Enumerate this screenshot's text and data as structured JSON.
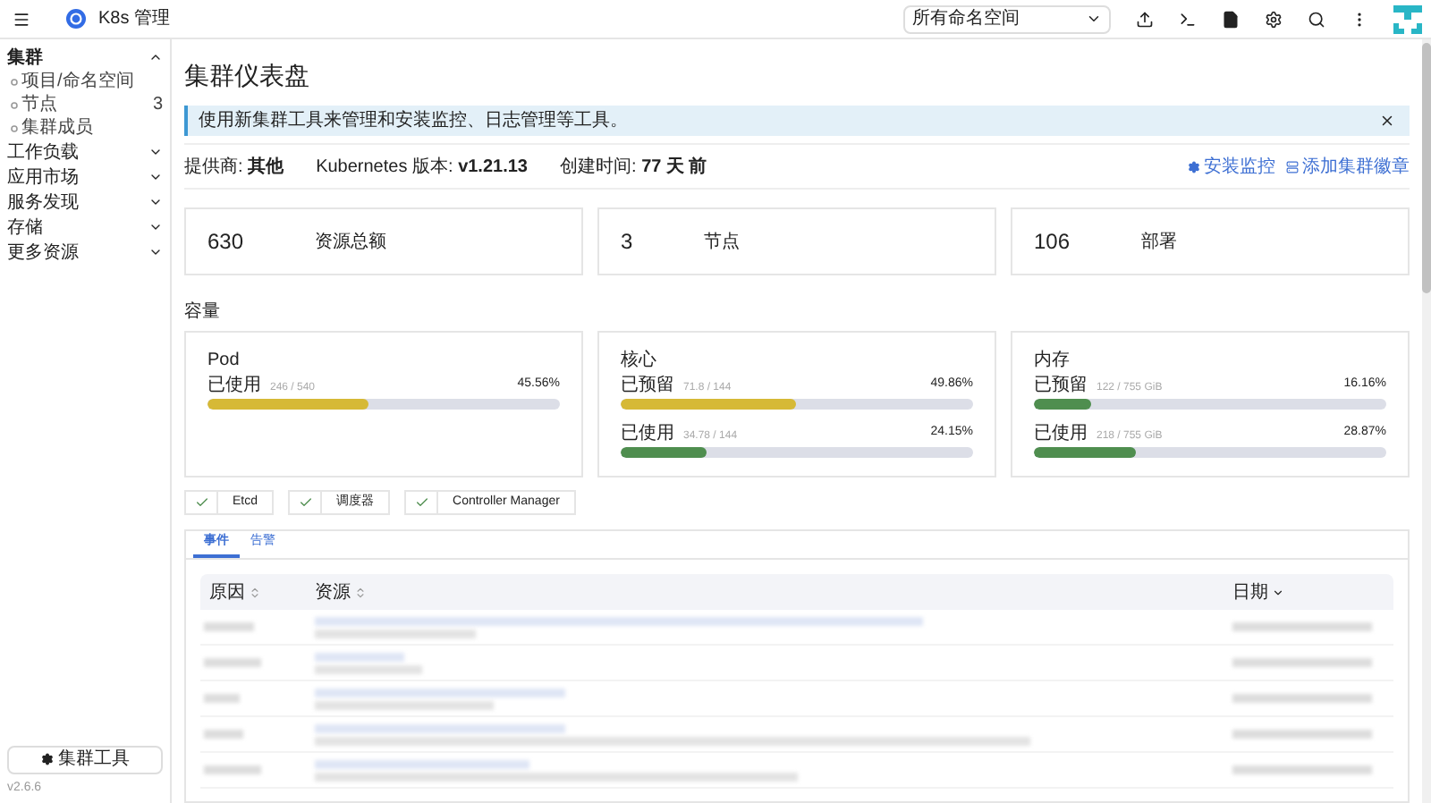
{
  "header": {
    "title": "K8s 管理",
    "namespace_select": "所有命名空间"
  },
  "sidebar": {
    "groups": [
      {
        "label": "集群",
        "expanded": true,
        "children": [
          {
            "label": "项目/命名空间"
          },
          {
            "label": "节点",
            "count": "3"
          },
          {
            "label": "集群成员"
          }
        ]
      },
      {
        "label": "工作负载",
        "expanded": false
      },
      {
        "label": "应用市场",
        "expanded": false
      },
      {
        "label": "服务发现",
        "expanded": false
      },
      {
        "label": "存储",
        "expanded": false
      },
      {
        "label": "更多资源",
        "expanded": false
      }
    ],
    "tools_button": "集群工具",
    "version": "v2.6.6"
  },
  "page": {
    "title": "集群仪表盘",
    "alert": "使用新集群工具来管理和安装监控、日志管理等工具。",
    "info": [
      {
        "label": "提供商:",
        "value": "其他"
      },
      {
        "label": "Kubernetes 版本:",
        "value": "v1.21.13"
      },
      {
        "label": "创建时间:",
        "value": "77 天 前"
      }
    ],
    "actions": [
      "安装监控",
      "添加集群徽章"
    ],
    "stats": [
      {
        "count": "630",
        "name": "资源总额"
      },
      {
        "count": "3",
        "name": "节点"
      },
      {
        "count": "106",
        "name": "部署"
      }
    ],
    "capacity_title": "容量",
    "capacity": [
      {
        "title": "Pod",
        "bars": [
          {
            "label": "已使用",
            "detail": "246 / 540",
            "percent": "45.56%",
            "level": 0.4556,
            "color": "#d6b936"
          }
        ]
      },
      {
        "title": "核心",
        "bars": [
          {
            "label": "已预留",
            "detail": "71.8 / 144",
            "percent": "49.86%",
            "level": 0.4986,
            "color": "#d6b936"
          },
          {
            "label": "已使用",
            "detail": "34.78 / 144",
            "percent": "24.15%",
            "level": 0.2415,
            "color": "#4f8e4f"
          }
        ]
      },
      {
        "title": "内存",
        "bars": [
          {
            "label": "已预留",
            "detail": "122 / 755 GiB",
            "percent": "16.16%",
            "level": 0.1616,
            "color": "#4f8e4f"
          },
          {
            "label": "已使用",
            "detail": "218 / 755 GiB",
            "percent": "28.87%",
            "level": 0.2887,
            "color": "#4f8e4f"
          }
        ]
      }
    ],
    "components": [
      {
        "label": "Etcd",
        "healthy": true
      },
      {
        "label": "调度器",
        "healthy": true
      },
      {
        "label": "Controller Manager",
        "healthy": true
      }
    ],
    "tabs": [
      {
        "label": "事件",
        "selected": true
      },
      {
        "label": "告警",
        "selected": false
      }
    ],
    "table": {
      "columns": [
        "原因",
        "资源",
        "日期"
      ]
    }
  }
}
